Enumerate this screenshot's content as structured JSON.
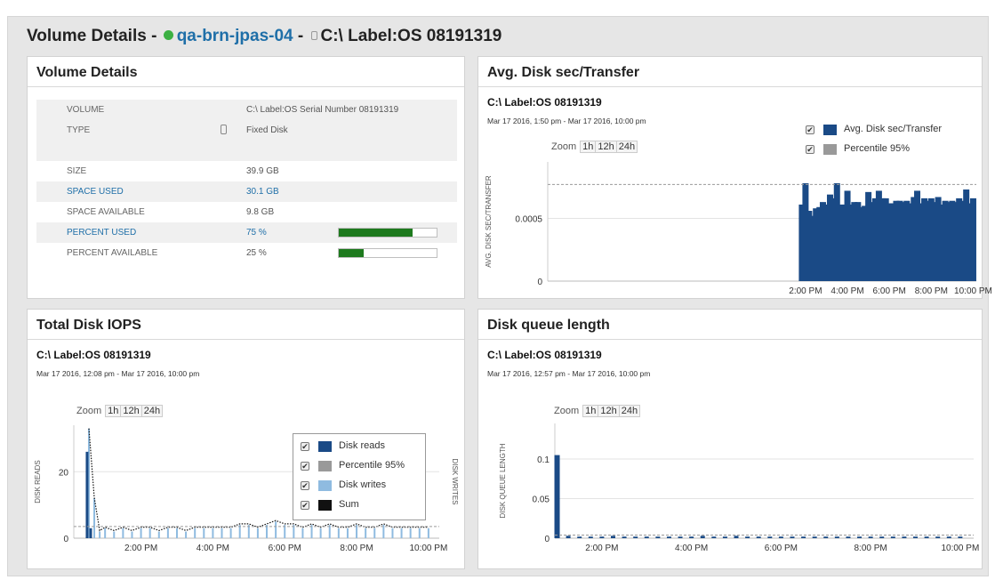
{
  "header": {
    "prefix": "Volume Details -",
    "node": "qa-brn-jpas-04",
    "sep": "-",
    "volume": "C:\\ Label:OS 08191319",
    "status_color": "#3cb043"
  },
  "volume_details": {
    "title": "Volume Details",
    "rows": [
      {
        "label": "VOLUME",
        "value": "C:\\ Label:OS Serial Number 08191319",
        "link": false,
        "shade": true
      },
      {
        "label": "TYPE",
        "value": "Fixed Disk",
        "link": false,
        "shade": true,
        "icon": "disk-icon"
      },
      {
        "label": "",
        "value": "",
        "link": false,
        "shade": true
      },
      {
        "label": "SIZE",
        "value": "39.9 GB",
        "link": false,
        "shade": false
      },
      {
        "label": "SPACE USED",
        "value": "30.1 GB",
        "link": true,
        "shade": true
      },
      {
        "label": "SPACE AVAILABLE",
        "value": "9.8 GB",
        "link": false,
        "shade": false
      },
      {
        "label": "PERCENT USED",
        "value": "75 %",
        "link": true,
        "shade": true,
        "progress": 0.75
      },
      {
        "label": "PERCENT AVAILABLE",
        "value": "25 %",
        "link": false,
        "shade": false,
        "progress": 0.25
      }
    ]
  },
  "zoom": {
    "label": "Zoom",
    "options": [
      "1h",
      "12h",
      "24h"
    ]
  },
  "avg_disk": {
    "title": "Avg. Disk sec/Transfer",
    "chart_title": "C:\\ Label:OS 08191319",
    "range": "Mar 17 2016, 1:50 pm - Mar 17 2016, 10:00 pm",
    "legend": [
      {
        "name": "Avg. Disk sec/Transfer",
        "color": "#1a4a86",
        "checked": true
      },
      {
        "name": "Percentile 95%",
        "color": "#999999",
        "checked": true
      }
    ],
    "chart_data": {
      "type": "bar",
      "ylabel": "AVG. DISK SEC/TRANSFER",
      "ylim": [
        0,
        0.00095
      ],
      "yticks": [
        0,
        0.0005
      ],
      "ytick_labels": [
        "0",
        "0.0005"
      ],
      "xlim": [
        1.7,
        22.15
      ],
      "xticks": [
        14,
        16,
        18,
        20,
        22
      ],
      "xtick_labels": [
        "2:00 PM",
        "4:00 PM",
        "6:00 PM",
        "8:00 PM",
        "10:00 PM"
      ],
      "x": [
        13.83,
        14.0,
        14.17,
        14.33,
        14.5,
        14.67,
        14.83,
        15.0,
        15.17,
        15.33,
        15.5,
        15.67,
        15.83,
        16.0,
        16.17,
        16.33,
        16.5,
        16.67,
        16.83,
        17.0,
        17.17,
        17.33,
        17.5,
        17.67,
        17.83,
        18.0,
        18.17,
        18.33,
        18.5,
        18.67,
        18.83,
        19.0,
        19.17,
        19.33,
        19.5,
        19.67,
        19.83,
        20.0,
        20.17,
        20.33,
        20.5,
        20.67,
        20.83,
        21.0,
        21.17,
        21.33,
        21.5,
        21.67,
        21.83,
        22.0
      ],
      "values": [
        0.00061,
        0.00078,
        0.00056,
        0.00052,
        0.00058,
        0.00059,
        0.00063,
        0.00061,
        0.00069,
        0.00066,
        0.00078,
        0.00061,
        0.00061,
        0.00072,
        0.00061,
        0.00063,
        0.00063,
        0.00059,
        0.0006,
        0.00071,
        0.00063,
        0.00066,
        0.00072,
        0.00066,
        0.00066,
        0.00062,
        0.00062,
        0.00064,
        0.00064,
        0.00063,
        0.00064,
        0.00062,
        0.00067,
        0.00072,
        0.00062,
        0.00066,
        0.00064,
        0.00066,
        0.00063,
        0.00067,
        0.00061,
        0.00064,
        0.00063,
        0.00064,
        0.00063,
        0.00066,
        0.00064,
        0.00073,
        0.00062,
        0.00066
      ],
      "percentile": 0.00077,
      "series": [
        {
          "name": "Avg. Disk sec/Transfer"
        },
        {
          "name": "Percentile 95%"
        }
      ]
    }
  },
  "iops": {
    "title": "Total Disk IOPS",
    "chart_title": "C:\\ Label:OS 08191319",
    "range": "Mar 17 2016, 12:08 pm - Mar 17 2016, 10:00 pm",
    "legend": [
      {
        "name": "Disk reads",
        "color": "#1a4a86",
        "checked": true
      },
      {
        "name": "Percentile 95%",
        "color": "#999999",
        "checked": true
      },
      {
        "name": "Disk writes",
        "color": "#8fbbe0",
        "checked": true
      },
      {
        "name": "Sum",
        "color": "#111111",
        "checked": true
      }
    ],
    "chart_data": {
      "type": "line",
      "ylabel": "DISK READS",
      "y2label": "DISK WRITES",
      "ylim": [
        0,
        34
      ],
      "yticks": [
        0,
        20
      ],
      "ytick_labels": [
        "0",
        "20"
      ],
      "xlim": [
        12.13,
        22.3
      ],
      "xticks": [
        14,
        16,
        18,
        20,
        22
      ],
      "xtick_labels": [
        "2:00 PM",
        "4:00 PM",
        "6:00 PM",
        "8:00 PM",
        "10:00 PM"
      ],
      "reads_x": [
        12.5,
        12.6
      ],
      "reads": [
        26,
        3
      ],
      "writes_x": [
        12.55,
        12.7,
        12.85,
        13.0,
        13.25,
        13.5,
        13.75,
        14.0,
        14.25,
        14.5,
        14.75,
        15.0,
        15.25,
        15.5,
        15.75,
        16.0,
        16.25,
        16.5,
        16.75,
        17.0,
        17.25,
        17.5,
        17.75,
        18.0,
        18.25,
        18.5,
        18.75,
        19.0,
        19.25,
        19.5,
        19.75,
        20.0,
        20.25,
        20.5,
        20.75,
        21.0,
        21.25,
        21.5,
        21.75,
        22.0
      ],
      "writes": [
        33,
        12,
        2,
        3,
        2,
        3,
        2,
        3,
        3,
        2,
        3,
        3,
        2,
        3,
        3,
        3,
        3,
        3,
        4,
        4,
        3,
        4,
        5,
        4,
        4,
        3,
        4,
        3,
        4,
        3,
        3,
        4,
        3,
        3,
        4,
        3,
        3,
        3,
        3,
        3
      ],
      "percentile": 3.5,
      "series": [
        {
          "name": "Disk reads"
        },
        {
          "name": "Percentile 95%"
        },
        {
          "name": "Disk writes"
        },
        {
          "name": "Sum"
        }
      ]
    }
  },
  "queue": {
    "title": "Disk queue length",
    "chart_title": "C:\\ Label:OS 08191319",
    "range": "Mar 17 2016, 12:57 pm - Mar 17 2016, 10:00 pm",
    "chart_data": {
      "type": "bar",
      "ylabel": "DISK QUEUE LENGTH",
      "ylim": [
        0,
        0.145
      ],
      "yticks": [
        0,
        0.05,
        0.1
      ],
      "ytick_labels": [
        "0",
        "0.05",
        "0.1"
      ],
      "xlim": [
        12.95,
        22.3
      ],
      "xticks": [
        14,
        16,
        18,
        20,
        22
      ],
      "xtick_labels": [
        "2:00 PM",
        "4:00 PM",
        "6:00 PM",
        "8:00 PM",
        "10:00 PM"
      ],
      "x": [
        13.0,
        13.25,
        13.5,
        13.75,
        14.0,
        14.25,
        14.5,
        14.75,
        15.0,
        15.25,
        15.5,
        15.75,
        16.0,
        16.25,
        16.5,
        16.75,
        17.0,
        17.25,
        17.5,
        17.75,
        18.0,
        18.25,
        18.5,
        18.75,
        19.0,
        19.25,
        19.5,
        19.75,
        20.0,
        20.25,
        20.5,
        20.75,
        21.0,
        21.25,
        21.5,
        21.75,
        22.0
      ],
      "values": [
        0.105,
        0.003,
        0.002,
        0.002,
        0.002,
        0.003,
        0.002,
        0.002,
        0.002,
        0.002,
        0.002,
        0.002,
        0.002,
        0.003,
        0.002,
        0.002,
        0.003,
        0.002,
        0.002,
        0.002,
        0.002,
        0.002,
        0.002,
        0.002,
        0.002,
        0.002,
        0.002,
        0.002,
        0.002,
        0.002,
        0.002,
        0.002,
        0.002,
        0.002,
        0.002,
        0.002,
        0.002
      ],
      "percentile": 0.004
    }
  }
}
